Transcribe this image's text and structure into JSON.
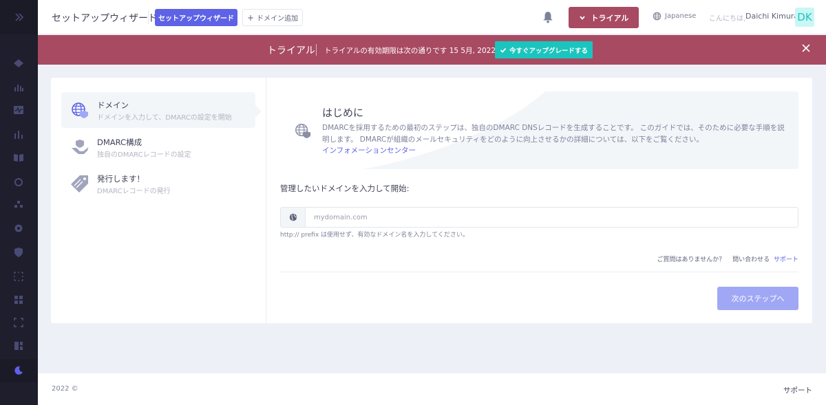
{
  "header": {
    "page_title": "セットアップウィザード",
    "wizard_button": "セットアップウィザード",
    "add_domain_button": "ドメイン追加",
    "trial_button": "トライアル",
    "language": "Japanese",
    "greeting": "こんにちは,",
    "username": "Daichi Kimura",
    "avatar_initials": "DK"
  },
  "banner": {
    "label": "トライアル",
    "text": "トライアルの有効期限は次の通りです 15 5月, 2022",
    "upgrade_button": "今すぐアップグレードする"
  },
  "steps": [
    {
      "title": "ドメイン",
      "desc": "ドメインを入力して、DMARCの設定を開始",
      "icon": "globe-shield-icon",
      "active": true
    },
    {
      "title": "DMARC構成",
      "desc": "独自のDMARCレコードの設定",
      "icon": "hand-shield-icon",
      "active": false
    },
    {
      "title": "発行します！",
      "desc": "DMARCレコードの発行",
      "icon": "tags-icon",
      "active": false
    }
  ],
  "intro": {
    "title": "はじめに",
    "text": "DMARCを採用するための最初のステップは、独自のDMARC DNSレコードを生成することです。 このガイドでは、そのために必要な手順を説明します。 DMARCが組織のメールセキュリティをどのように向上させるかの詳細については、以下をご覧ください。",
    "link": "インフォメーションセンター"
  },
  "form": {
    "label": "管理したいドメインを入力して開始:",
    "placeholder": "mydomain.com",
    "value": "",
    "hint": "http:// prefix は使用せず、有効なドメイン名を入力してください。"
  },
  "help": {
    "question": "ご質問はありませんか？",
    "contact": "問い合わせる",
    "support": "サポート"
  },
  "next_button": "次のステップへ",
  "footer": {
    "copyright": "2022 ©",
    "support": "サポート"
  },
  "colors": {
    "primary": "#5d62e6",
    "trial": "#a84a62",
    "upgrade": "#1bc5bd",
    "sidebar": "#1e1e2d"
  }
}
